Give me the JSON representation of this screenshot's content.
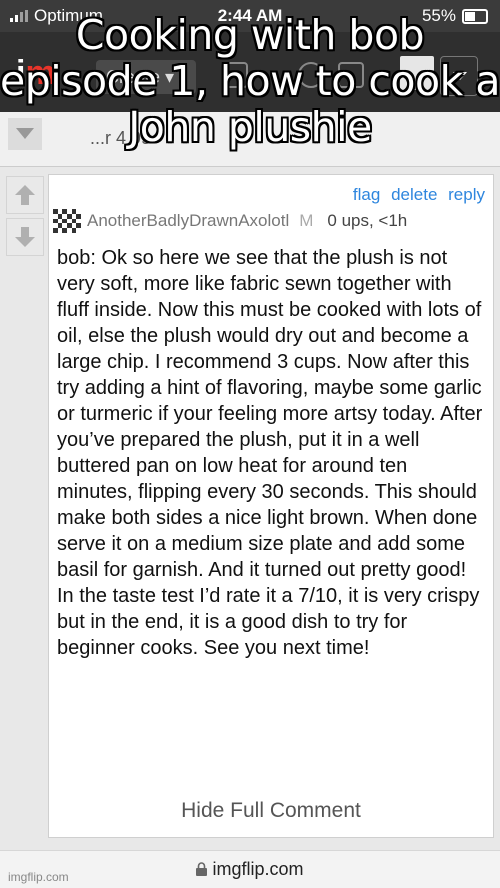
{
  "status_bar": {
    "carrier": "Optimum",
    "time": "2:44 AM",
    "battery": "55%"
  },
  "navbar": {
    "logo_i": "i",
    "logo_m": "m",
    "create_label": "Create ▾"
  },
  "prev_comment": {
    "partial_text": "...r 4 99"
  },
  "caption": "Cooking with bob episode 1, how to cook a John plushie",
  "comment": {
    "actions": {
      "flag": "flag",
      "delete": "delete",
      "reply": "reply"
    },
    "username": "AnotherBadlyDrawnAxolotl",
    "mod_badge": "M",
    "meta": "0 ups, <1h",
    "text": "bob: Ok so here we see that the plush is not very soft, more like fabric sewn together with fluff inside. Now this must be cooked with lots of oil, else the plush would dry out and become a large chip. I recommend 3 cups. Now after this try adding a hint of flavoring, maybe some garlic or turmeric if your feeling more artsy today. After you’ve prepared the plush, put it in a well buttered pan on low heat for around ten minutes, flipping every 30 seconds. This should make both sides a nice light brown. When done serve it on a medium size plate and add some basil for garnish. And it turned out pretty good! In the taste test I’d rate it a 7/10, it is very crispy but in the end, it is a good dish to try for beginner cooks. See you next time!",
    "hide_label": "Hide Full Comment"
  },
  "url_bar": {
    "url": "imgflip.com"
  },
  "watermark": "imgflip.com",
  "colors": {
    "link": "#2e86de",
    "nav_bg": "#2f2f2f",
    "logo_accent": "#e8342a"
  }
}
